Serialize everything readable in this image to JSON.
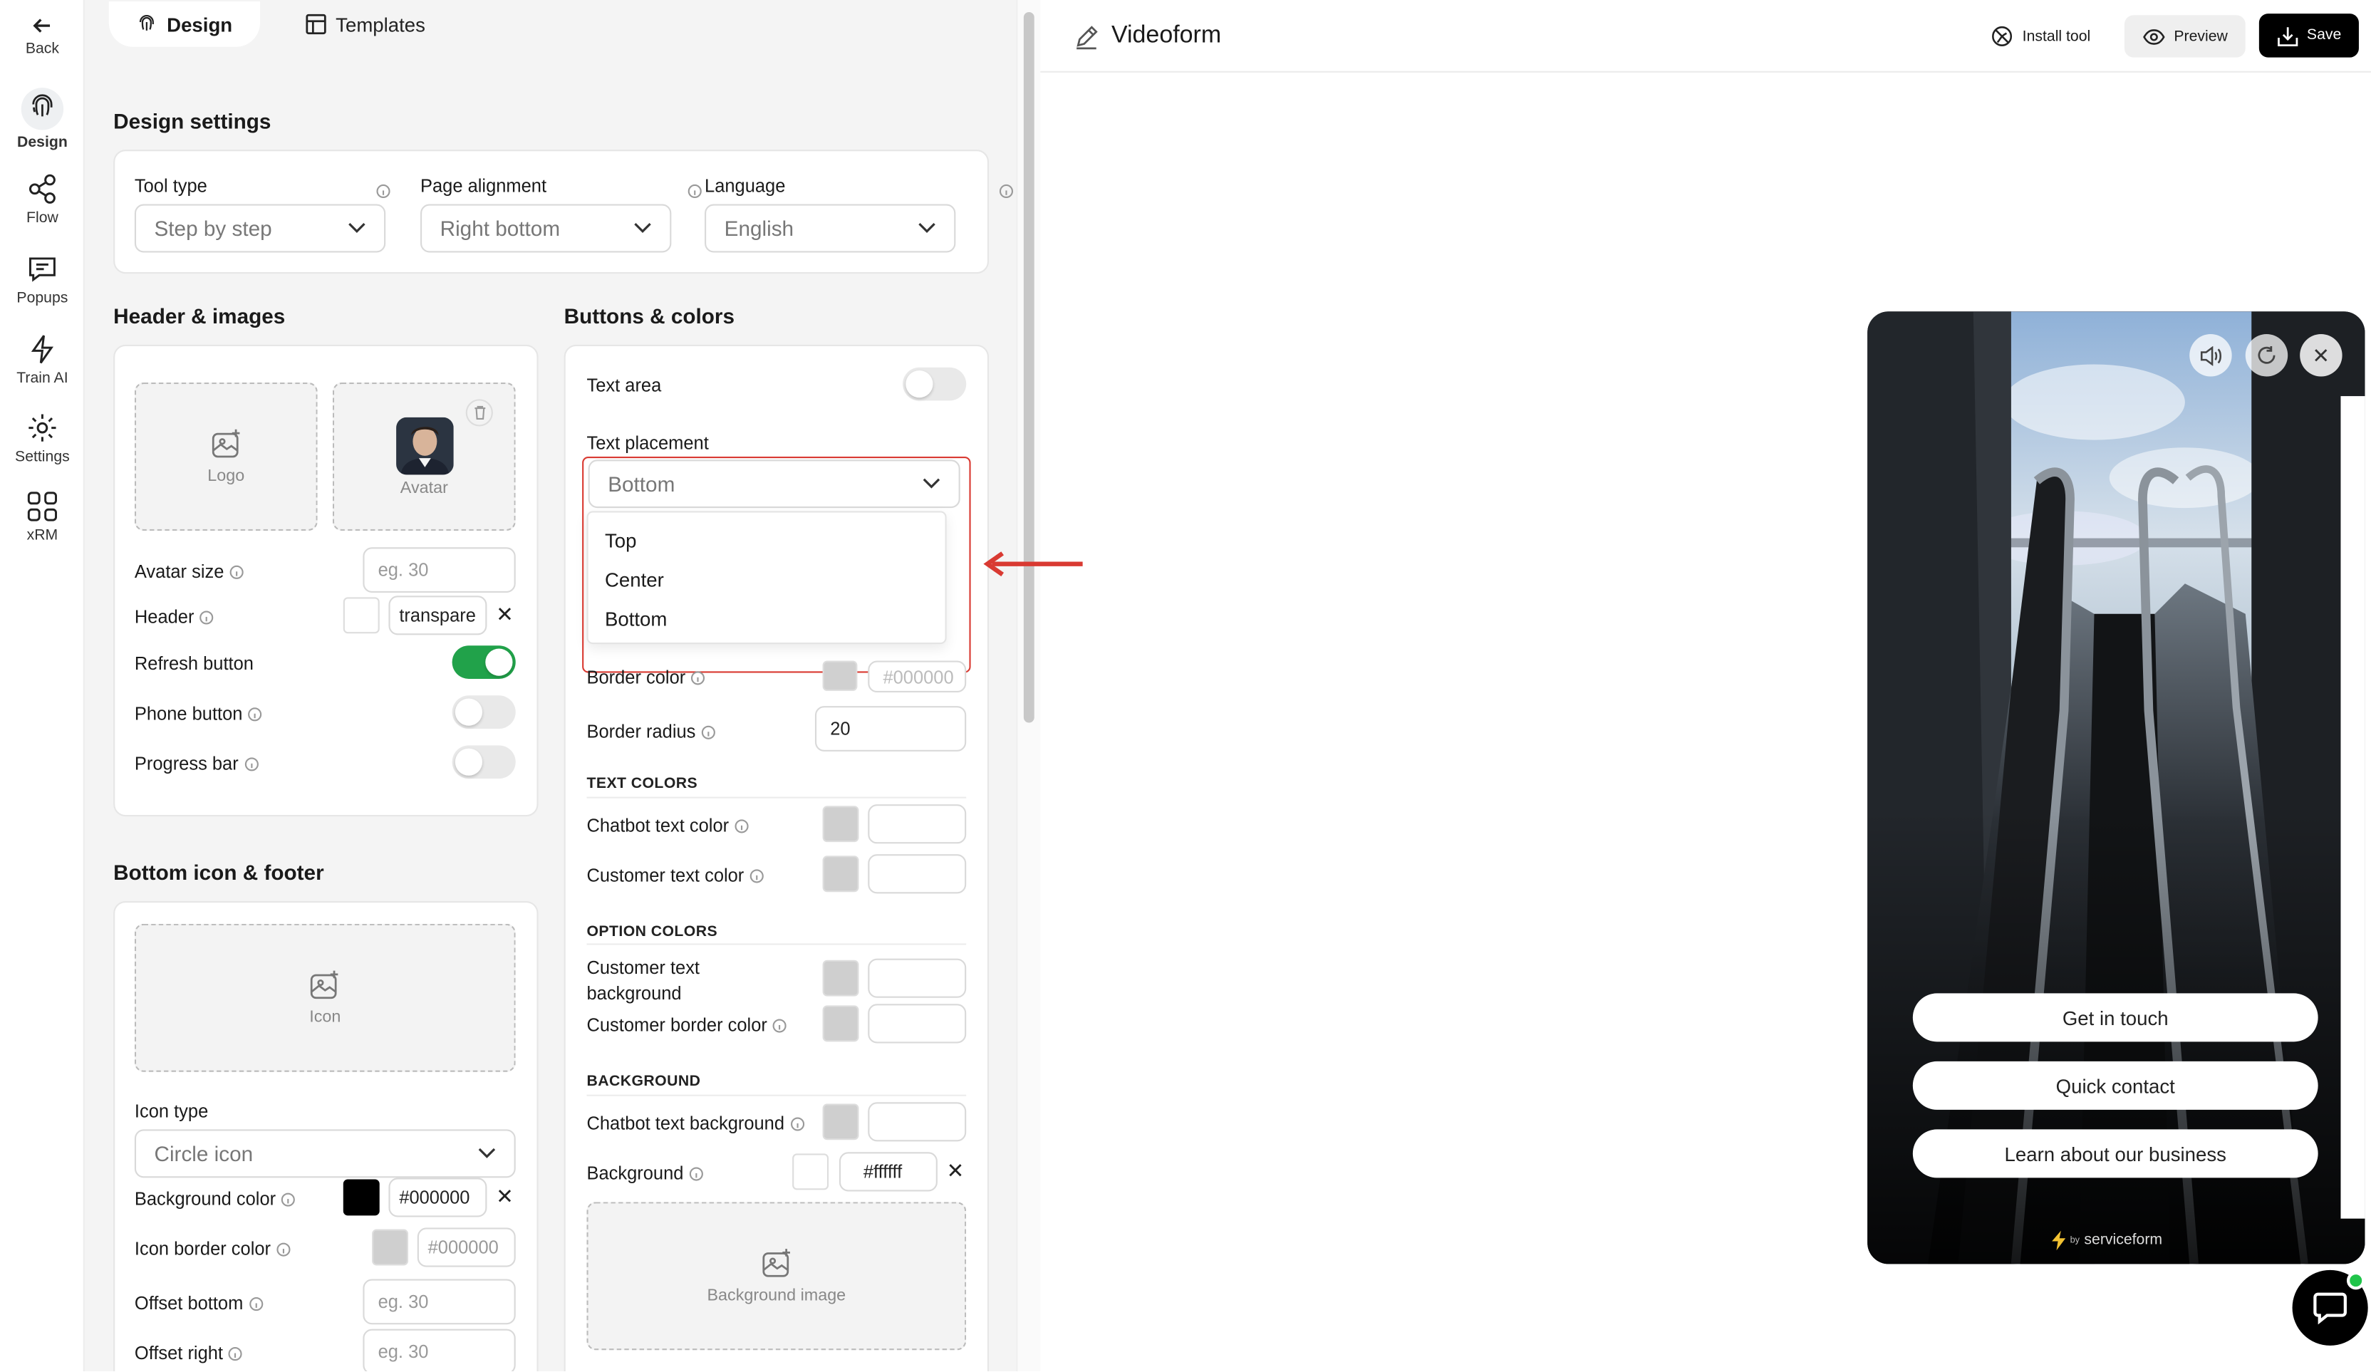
{
  "rail": {
    "back": "Back",
    "items": [
      {
        "label": "Design",
        "icon": "fingerprint-icon"
      },
      {
        "label": "Flow",
        "icon": "share-icon"
      },
      {
        "label": "Popups",
        "icon": "message-icon"
      },
      {
        "label": "Train AI",
        "icon": "lightning-icon"
      },
      {
        "label": "Settings",
        "icon": "gear-icon"
      },
      {
        "label": "xRM",
        "icon": "grid-icon"
      }
    ]
  },
  "tabs": {
    "design": "Design",
    "templates": "Templates"
  },
  "design_settings": {
    "title": "Design settings",
    "tool_type": {
      "label": "Tool type",
      "value": "Step by step"
    },
    "page_alignment": {
      "label": "Page alignment",
      "value": "Right bottom"
    },
    "language": {
      "label": "Language",
      "value": "English"
    }
  },
  "header_images": {
    "title": "Header & images",
    "logo": "Logo",
    "avatar": "Avatar",
    "avatar_size": {
      "label": "Avatar size",
      "placeholder": "eg. 30"
    },
    "header": {
      "label": "Header",
      "value": "transpare"
    },
    "refresh_button": {
      "label": "Refresh button",
      "on": true
    },
    "phone_button": {
      "label": "Phone button",
      "on": false
    },
    "progress_bar": {
      "label": "Progress bar",
      "on": false
    }
  },
  "bottom_icon": {
    "title": "Bottom icon & footer",
    "icon": "Icon",
    "icon_type": {
      "label": "Icon type",
      "value": "Circle icon"
    },
    "background_color": {
      "label": "Background color",
      "value": "#000000"
    },
    "icon_border_color": {
      "label": "Icon border color",
      "value": "#000000"
    },
    "offset_bottom": {
      "label": "Offset bottom",
      "placeholder": "eg. 30"
    },
    "offset_right": {
      "label": "Offset right",
      "placeholder": "eg. 30"
    }
  },
  "buttons_colors": {
    "title": "Buttons & colors",
    "text_area": {
      "label": "Text area",
      "on": false
    },
    "text_placement": {
      "label": "Text placement",
      "value": "Bottom",
      "options": [
        "Top",
        "Center",
        "Bottom"
      ]
    },
    "border_color": {
      "label": "Border color",
      "value": "#000000"
    },
    "border_radius": {
      "label": "Border radius",
      "value": "20"
    },
    "text_colors": "TEXT COLORS",
    "chatbot_text_color": "Chatbot text color",
    "customer_text_color": "Customer text color",
    "option_colors": "OPTION COLORS",
    "customer_text_background": "Customer text background",
    "customer_border_color": "Customer border color",
    "background_section": "BACKGROUND",
    "chatbot_text_background": "Chatbot text background",
    "background": {
      "label": "Background",
      "value": "#ffffff"
    },
    "background_image": "Background image"
  },
  "topbar": {
    "title": "Videoform",
    "install_tool": "Install tool",
    "preview": "Preview",
    "save": "Save"
  },
  "preview": {
    "buttons": [
      "Get in touch",
      "Quick contact",
      "Learn about our business"
    ],
    "brand": "serviceform",
    "brand_prefix": "by"
  },
  "colors": {
    "accent_green": "#21a24a",
    "annotation_red": "#d93a32",
    "primary": "#000000"
  }
}
